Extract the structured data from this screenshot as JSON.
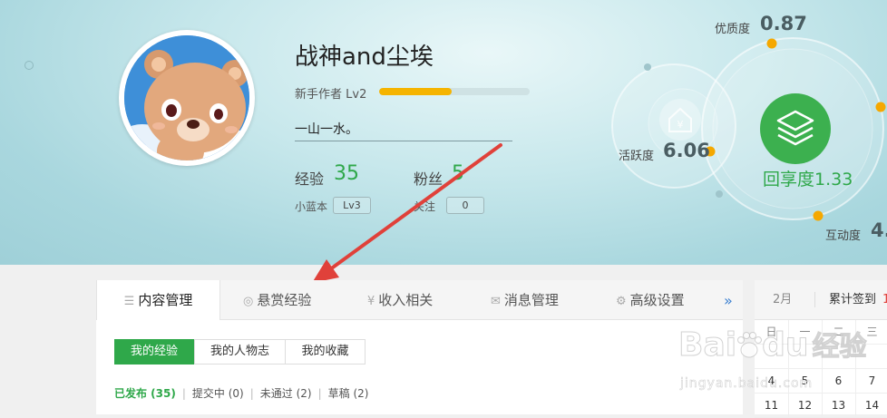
{
  "profile": {
    "username": "战神and尘埃",
    "level_label": "新手作者 Lv2",
    "level_progress": 0.48,
    "motto": "一山一水。",
    "exp_label": "经验",
    "exp_value": "35",
    "fans_label": "粉丝",
    "fans_value": "5",
    "blue_label": "小蓝本",
    "blue_level": "Lv3",
    "follow_label": "关注",
    "follow_value": "0"
  },
  "metrics": {
    "quality_label": "优质度",
    "quality_value": "0.87",
    "activity_label": "活跃度",
    "activity_value": "6.06",
    "reward_label": "回享度",
    "reward_value": "1.33",
    "interaction_label": "互动度",
    "interaction_value": "4."
  },
  "tabs": [
    {
      "label": "内容管理",
      "icon": "list-icon",
      "active": true
    },
    {
      "label": "悬赏经验",
      "icon": "reward-icon",
      "active": false
    },
    {
      "label": "收入相关",
      "icon": "yen-icon",
      "active": false
    },
    {
      "label": "消息管理",
      "icon": "mail-icon",
      "active": false
    },
    {
      "label": "高级设置",
      "icon": "gear-icon",
      "active": false
    }
  ],
  "more_icon": "»",
  "subtabs": [
    "我的经验",
    "我的人物志",
    "我的收藏"
  ],
  "filters": {
    "published": "已发布 (35)",
    "submitting": "提交中 (0)",
    "rejected": "未通过 (2)",
    "draft": "草稿 (2)"
  },
  "calendar": {
    "month": "2月",
    "signin_label": "累计签到",
    "signin_value": "1",
    "weekdays": [
      "日",
      "一",
      "二",
      "三"
    ],
    "row1": [
      "4",
      "5",
      "6",
      "7"
    ],
    "row2": [
      "11",
      "12",
      "13",
      "14"
    ]
  },
  "watermark": {
    "brand": "Bai",
    "brand2": "du",
    "cn": "经验",
    "url": "jingyan.baidu.com"
  },
  "colors": {
    "green": "#2fa84a",
    "orange": "#f5b400",
    "arrow": "#e0413a"
  }
}
